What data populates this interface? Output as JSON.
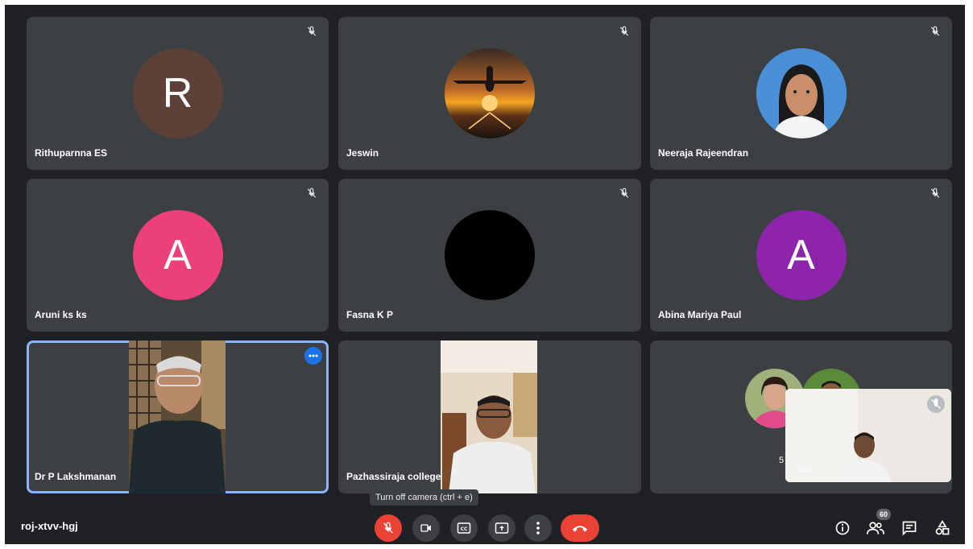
{
  "meeting": {
    "code": "roj-xtvv-hgj"
  },
  "participants": [
    {
      "name": "Rithuparnna ES",
      "initial": "R",
      "avatar_color": "#5d4037",
      "muted": true
    },
    {
      "name": "Jeswin",
      "avatar_type": "photo-airplane-sunset",
      "muted": true
    },
    {
      "name": "Neeraja Rajeendran",
      "avatar_type": "photo-portrait",
      "muted": true
    },
    {
      "name": "Aruni ks ks",
      "initial": "A",
      "avatar_color": "#ec407a",
      "muted": true
    },
    {
      "name": "Fasna K P",
      "avatar_type": "black-circle",
      "avatar_color": "#000000",
      "muted": true
    },
    {
      "name": "Abina Mariya Paul",
      "initial": "A",
      "avatar_color": "#8e24aa",
      "muted": true
    },
    {
      "name": "Dr P Lakshmanan",
      "video": true,
      "active_speaker": true
    },
    {
      "name": "Pazhassiraja college",
      "video": true
    },
    {
      "name": "5",
      "overflow_tile": true
    }
  ],
  "self_view": {
    "label": "You",
    "muted": true
  },
  "controls": {
    "tooltip": "Turn off camera (ctrl + e)",
    "mic": "mic-off-icon",
    "camera": "videocam-icon",
    "captions": "closed-captions-icon",
    "present": "present-screen-icon",
    "more": "more-vert-icon",
    "hangup": "call-end-icon"
  },
  "right_controls": {
    "people_count": "60",
    "info": "info-icon",
    "people": "people-icon",
    "chat": "chat-icon",
    "activities": "activities-icon"
  },
  "colors": {
    "background": "#202124",
    "tile": "#3c4043",
    "accent": "#8ab4f8",
    "danger": "#ea4335"
  }
}
